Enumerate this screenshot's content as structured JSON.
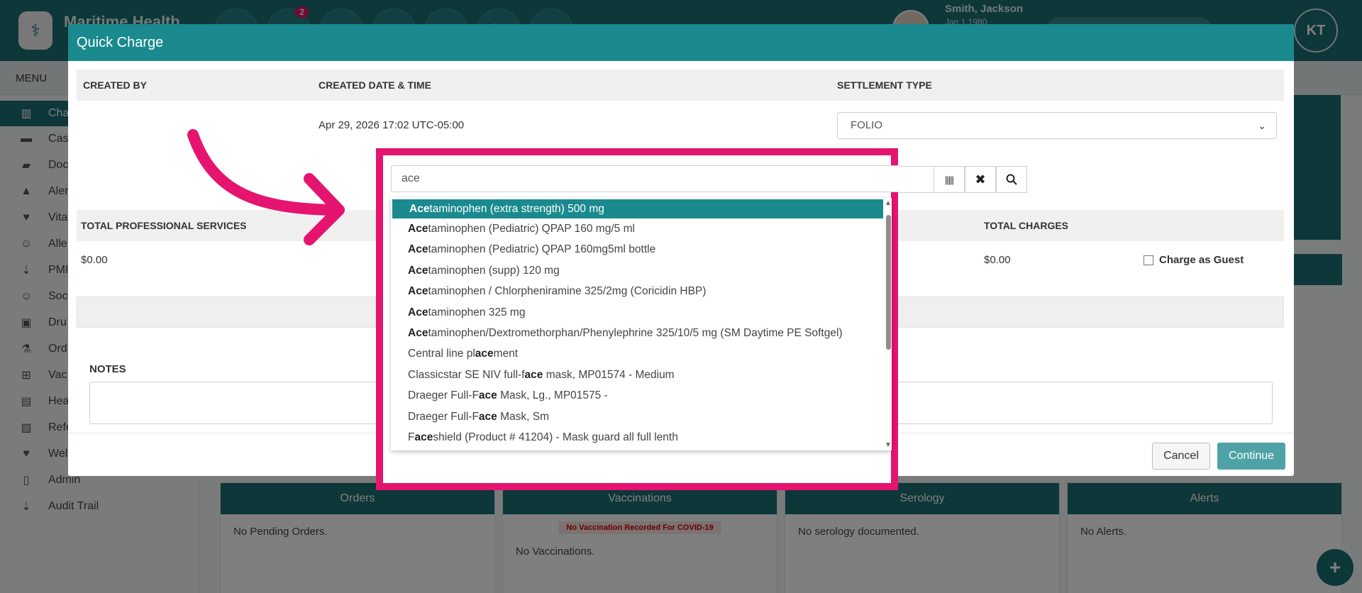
{
  "header": {
    "app_title": "Maritime Health",
    "badge_count": "2",
    "patient_name": "Smith, Jackson",
    "patient_dob": "Jan 1 1980",
    "user_initials": "KT"
  },
  "menu": {
    "label": "MENU"
  },
  "sidebar": {
    "items": [
      {
        "label": "Cha",
        "icon": "bar-chart-icon"
      },
      {
        "label": "Cas",
        "icon": "case-icon"
      },
      {
        "label": "Doc",
        "icon": "folder-icon"
      },
      {
        "label": "Aler",
        "icon": "warning-icon"
      },
      {
        "label": "Vita",
        "icon": "heart-icon"
      },
      {
        "label": "Alle",
        "icon": "allergy-icon"
      },
      {
        "label": "PMI",
        "icon": "sort-icon"
      },
      {
        "label": "Soc",
        "icon": "social-icon"
      },
      {
        "label": "Dru",
        "icon": "medkit-icon"
      },
      {
        "label": "Ord",
        "icon": "flask-icon"
      },
      {
        "label": "Vac",
        "icon": "plus-square-icon"
      },
      {
        "label": "Hea",
        "icon": "calendar-icon"
      },
      {
        "label": "Refe",
        "icon": "image-icon"
      },
      {
        "label": "Wel",
        "icon": "heartbeat-icon"
      },
      {
        "label": "Admin",
        "icon": "file-icon"
      },
      {
        "label": "Audit Trail",
        "icon": "list-sort-icon"
      }
    ]
  },
  "cards": [
    {
      "title": "Orders",
      "body": "No Pending Orders."
    },
    {
      "title": "Vaccinations",
      "warning": "No Vaccination Recorded For COVID-19",
      "body": "No Vaccinations."
    },
    {
      "title": "Serology",
      "body": "No serology documented."
    },
    {
      "title": "Alerts",
      "body": "No Alerts."
    }
  ],
  "modal": {
    "title": "Quick Charge",
    "created_by_label": "CREATED BY",
    "created_date_label": "CREATED DATE & TIME",
    "created_date_value": "Apr 29, 2026 17:02 UTC-05:00",
    "settlement_label": "SETTLEMENT TYPE",
    "settlement_value": "FOLIO",
    "total_prof_label": "TOTAL PROFESSIONAL SERVICES",
    "total_prof_value": "$0.00",
    "total_charges_label": "TOTAL CHARGES",
    "total_charges_value": "$0.00",
    "charge_guest_label": "Charge as Guest",
    "notes_label": "NOTES",
    "cancel_label": "Cancel",
    "continue_label": "Continue"
  },
  "autocomplete": {
    "query": "ace",
    "items": [
      {
        "pre": "",
        "match": "Ace",
        "post": "taminophen (extra strength) 500 mg"
      },
      {
        "pre": "",
        "match": "Ace",
        "post": "taminophen (Pediatric) QPAP 160 mg/5 ml"
      },
      {
        "pre": "",
        "match": "Ace",
        "post": "taminophen (Pediatric) QPAP 160mg5ml bottle"
      },
      {
        "pre": "",
        "match": "Ace",
        "post": "taminophen (supp) 120 mg"
      },
      {
        "pre": "",
        "match": "Ace",
        "post": "taminophen / Chlorpheniramine 325/2mg (Coricidin HBP)"
      },
      {
        "pre": "",
        "match": "Ace",
        "post": "taminophen 325 mg"
      },
      {
        "pre": "",
        "match": "Ace",
        "post": "taminophen/Dextromethorphan/Phenylephrine 325/10/5 mg (SM Daytime PE Softgel)"
      },
      {
        "pre": "Central line pl",
        "match": "ace",
        "post": "ment"
      },
      {
        "pre": "Classicstar SE NIV full-f",
        "match": "ace",
        "post": " mask, MP01574 - Medium"
      },
      {
        "pre": "Draeger Full-F",
        "match": "ace",
        "post": " Mask, Lg., MP01575 -"
      },
      {
        "pre": "Draeger Full-F",
        "match": "ace",
        "post": " Mask, Sm"
      },
      {
        "pre": "F",
        "match": "ace",
        "post": "shield (Product # 41204) - Mask guard all full lenth"
      }
    ]
  },
  "colors": {
    "primary": "#1a6f73",
    "accent": "#1a8a8f",
    "highlight": "#e5146f"
  }
}
